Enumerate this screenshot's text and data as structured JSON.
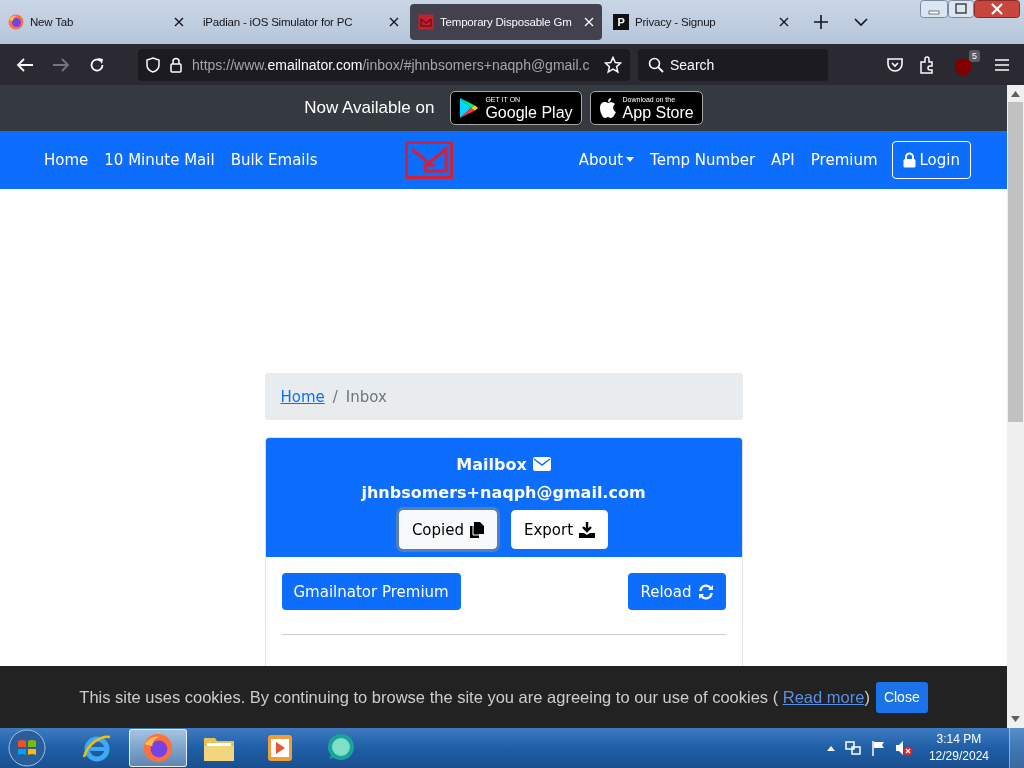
{
  "browser": {
    "tabs": [
      {
        "title": "New Tab",
        "kind": "firefox",
        "selected": false
      },
      {
        "title": "iPadian - iOS Simulator for PC",
        "kind": "plain",
        "selected": false
      },
      {
        "title": "Temporary Disposable Gm",
        "kind": "mail",
        "selected": true
      },
      {
        "title": "Privacy - Signup",
        "kind": "letter",
        "icon_text": "P",
        "selected": false
      }
    ],
    "url": {
      "scheme": "https://www.",
      "domain": "emailnator.com",
      "path": "/inbox/#jhnbsomers+naqph@gmail.c"
    },
    "search": {
      "placeholder": "Search"
    },
    "extension_badge": "5"
  },
  "app_banner": {
    "text": "Now Available on",
    "badges": [
      {
        "kind": "google",
        "small": "GET IT ON",
        "big": "Google Play"
      },
      {
        "kind": "apple",
        "small": "Download on the",
        "big": "App Store"
      }
    ]
  },
  "navbar": {
    "left": [
      "Home",
      "10 Minute Mail",
      "Bulk Emails"
    ],
    "right": [
      {
        "label": "About",
        "kind": "dropdown"
      },
      {
        "label": "Temp Number",
        "kind": "link"
      },
      {
        "label": "API",
        "kind": "link"
      },
      {
        "label": "Premium",
        "kind": "link"
      },
      {
        "label": "Login",
        "kind": "button"
      }
    ]
  },
  "breadcrumb": {
    "separator": "/",
    "items": [
      {
        "label": "Home",
        "kind": "link"
      },
      {
        "label": "Inbox",
        "kind": "current"
      }
    ]
  },
  "mailbox": {
    "title": "Mailbox",
    "address": "jhnbsomers+naqph@gmail.com",
    "buttons": [
      {
        "label": "Copied",
        "kind": "copy",
        "focused": true
      },
      {
        "label": "Export",
        "kind": "export",
        "focused": false
      }
    ]
  },
  "actions": [
    {
      "label": "Gmailnator Premium",
      "kind": "premium"
    },
    {
      "label": "Reload",
      "kind": "reload"
    }
  ],
  "cookie_bar": {
    "text": "This site uses cookies. By continuing to browse the site you are agreeing to our use of cookies (",
    "link": "Read more",
    "after": ")",
    "button": "Close"
  },
  "taskbar": {
    "apps": [
      {
        "kind": "ie",
        "selected": false
      },
      {
        "kind": "firefox",
        "selected": true
      },
      {
        "kind": "folder",
        "selected": false
      },
      {
        "kind": "media",
        "selected": false
      },
      {
        "kind": "chat",
        "selected": false
      }
    ],
    "time": "3:14 PM",
    "date": "12/29/2024"
  }
}
